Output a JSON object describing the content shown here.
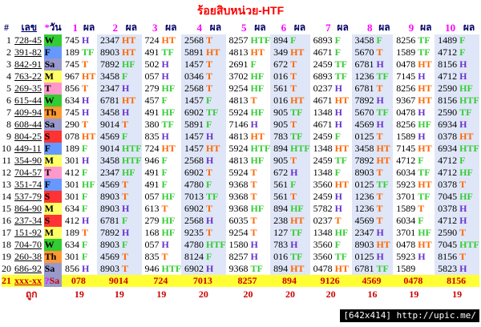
{
  "title": "ร้อยสิบหน่วย-HTF",
  "headers": {
    "hash": "#",
    "lek": "เลข",
    "star": "*",
    "wan": "วัน",
    "phl": "ผล",
    "ranks": [
      "1",
      "2",
      "3",
      "4",
      "5",
      "6",
      "7",
      "8",
      "9",
      "10"
    ]
  },
  "day_colors": {
    "W": "#33cc33",
    "F": "#6699ff",
    "Sa": "#9999cc",
    "M": "#ffff66",
    "T": "#ff99cc",
    "S": "#ff3333",
    "Th": "#ff9933"
  },
  "letter_colors": {
    "H": "#6633cc",
    "T": "#ff6600",
    "F": "#33cc33",
    "HT": "#ff6600",
    "TF": "#33cc33",
    "HF": "#33cc33",
    "HTF": "#33cc33"
  },
  "rows": [
    {
      "n": "1",
      "lek": "728-45",
      "day": "W",
      "c": [
        [
          "745",
          "H"
        ],
        [
          "2347",
          "HT"
        ],
        [
          "724",
          "HT"
        ],
        [
          "2568",
          "T"
        ],
        [
          "8257",
          "HTF"
        ],
        [
          "894",
          "F"
        ],
        [
          "6893",
          "F"
        ],
        [
          "3458",
          "F"
        ],
        [
          "8256",
          "TF"
        ],
        [
          "1489",
          "F"
        ]
      ]
    },
    {
      "n": "2",
      "lek": "391-82",
      "day": "F",
      "c": [
        [
          "189",
          "TF"
        ],
        [
          "8903",
          "HT"
        ],
        [
          "491",
          "TF"
        ],
        [
          "5891",
          "HT"
        ],
        [
          "4813",
          "HT"
        ],
        [
          "349",
          "HT"
        ],
        [
          "4671",
          "F"
        ],
        [
          "5670",
          "T"
        ],
        [
          "1589",
          "TF"
        ],
        [
          "4712",
          "F"
        ]
      ]
    },
    {
      "n": "3",
      "lek": "842-91",
      "day": "Sa",
      "c": [
        [
          "745",
          "T"
        ],
        [
          "7892",
          "HF"
        ],
        [
          "502",
          "H"
        ],
        [
          "1457",
          "T"
        ],
        [
          "2691",
          "F"
        ],
        [
          "672",
          "T"
        ],
        [
          "2459",
          "TF"
        ],
        [
          "6781",
          "H"
        ],
        [
          "0478",
          "HT"
        ],
        [
          "8156",
          "H"
        ]
      ]
    },
    {
      "n": "4",
      "lek": "763-22",
      "day": "M",
      "c": [
        [
          "967",
          "HT"
        ],
        [
          "3458",
          "F"
        ],
        [
          "057",
          "H"
        ],
        [
          "0346",
          "T"
        ],
        [
          "3702",
          "HF"
        ],
        [
          "016",
          "T"
        ],
        [
          "6893",
          "TF"
        ],
        [
          "1236",
          "TF"
        ],
        [
          "7145",
          "H"
        ],
        [
          "4712",
          "H"
        ]
      ]
    },
    {
      "n": "5",
      "lek": "269-35",
      "day": "T",
      "c": [
        [
          "856",
          "T"
        ],
        [
          "2347",
          "H"
        ],
        [
          "279",
          "HF"
        ],
        [
          "2568",
          "T"
        ],
        [
          "9254",
          "HF"
        ],
        [
          "561",
          "T"
        ],
        [
          "0237",
          "H"
        ],
        [
          "6781",
          "T"
        ],
        [
          "8256",
          "HT"
        ],
        [
          "2590",
          "HF"
        ]
      ]
    },
    {
      "n": "6",
      "lek": "615-44",
      "day": "W",
      "c": [
        [
          "634",
          "H"
        ],
        [
          "6781",
          "HT"
        ],
        [
          "457",
          "F"
        ],
        [
          "1457",
          "F"
        ],
        [
          "4813",
          "T"
        ],
        [
          "016",
          "HT"
        ],
        [
          "4671",
          "HT"
        ],
        [
          "7892",
          "H"
        ],
        [
          "9367",
          "HT"
        ],
        [
          "8156",
          "HTF"
        ]
      ]
    },
    {
      "n": "7",
      "lek": "409-94",
      "day": "Th",
      "c": [
        [
          "745",
          "H"
        ],
        [
          "3458",
          "H"
        ],
        [
          "491",
          "HF"
        ],
        [
          "6902",
          "TF"
        ],
        [
          "5924",
          "HF"
        ],
        [
          "905",
          "TF"
        ],
        [
          "1348",
          "H"
        ],
        [
          "5670",
          "TF"
        ],
        [
          "0478",
          "H"
        ],
        [
          "2590",
          "TF"
        ]
      ]
    },
    {
      "n": "8",
      "lek": "608-44",
      "day": "Sa",
      "c": [
        [
          "290",
          "T"
        ],
        [
          "9014",
          "T"
        ],
        [
          "380",
          "TF"
        ],
        [
          "5891",
          "F"
        ],
        [
          "7146",
          "H"
        ],
        [
          "905",
          "T"
        ],
        [
          "4671",
          "H"
        ],
        [
          "4569",
          "H"
        ],
        [
          "8256",
          "HF"
        ],
        [
          "6934",
          "H"
        ]
      ]
    },
    {
      "n": "9",
      "lek": "804-25",
      "day": "S",
      "c": [
        [
          "078",
          "HT"
        ],
        [
          "4569",
          "F"
        ],
        [
          "835",
          "H"
        ],
        [
          "1457",
          "H"
        ],
        [
          "4813",
          "HT"
        ],
        [
          "783",
          "TF"
        ],
        [
          "2459",
          "F"
        ],
        [
          "0125",
          "T"
        ],
        [
          "1589",
          "H"
        ],
        [
          "0378",
          "HT"
        ]
      ]
    },
    {
      "n": "10",
      "lek": "449-11",
      "day": "F",
      "c": [
        [
          "189",
          "F"
        ],
        [
          "9014",
          "HTF"
        ],
        [
          "724",
          "HT"
        ],
        [
          "1457",
          "HT"
        ],
        [
          "5924",
          "HTF"
        ],
        [
          "894",
          "HTF"
        ],
        [
          "1348",
          "HT"
        ],
        [
          "3458",
          "HT"
        ],
        [
          "7145",
          "HT"
        ],
        [
          "6934",
          "HTF"
        ]
      ]
    },
    {
      "n": "11",
      "lek": "354-90",
      "day": "M",
      "c": [
        [
          "301",
          "H"
        ],
        [
          "3458",
          "HTF"
        ],
        [
          "946",
          "F"
        ],
        [
          "2568",
          "H"
        ],
        [
          "4813",
          "HF"
        ],
        [
          "905",
          "T"
        ],
        [
          "2459",
          "TF"
        ],
        [
          "7892",
          "HT"
        ],
        [
          "4712",
          "F"
        ],
        [
          "4712",
          "F"
        ]
      ]
    },
    {
      "n": "12",
      "lek": "704-57",
      "day": "T",
      "c": [
        [
          "412",
          "F"
        ],
        [
          "2347",
          "HF"
        ],
        [
          "491",
          "F"
        ],
        [
          "6902",
          "T"
        ],
        [
          "5924",
          "T"
        ],
        [
          "672",
          "H"
        ],
        [
          "1348",
          "F"
        ],
        [
          "8903",
          "T"
        ],
        [
          "6034",
          "TF"
        ],
        [
          "4712",
          "HF"
        ]
      ]
    },
    {
      "n": "13",
      "lek": "351-74",
      "day": "F",
      "c": [
        [
          "301",
          "HF"
        ],
        [
          "4569",
          "T"
        ],
        [
          "491",
          "F"
        ],
        [
          "4780",
          "F"
        ],
        [
          "9368",
          "T"
        ],
        [
          "561",
          "F"
        ],
        [
          "3560",
          "HT"
        ],
        [
          "0125",
          "TF"
        ],
        [
          "5923",
          "HT"
        ],
        [
          "0378",
          "T"
        ]
      ]
    },
    {
      "n": "14",
      "lek": "537-79",
      "day": "S",
      "c": [
        [
          "301",
          "F"
        ],
        [
          "8903",
          "T"
        ],
        [
          "057",
          "HF"
        ],
        [
          "7013",
          "TF"
        ],
        [
          "9368",
          "T"
        ],
        [
          "561",
          "T"
        ],
        [
          "2459",
          "H"
        ],
        [
          "1236",
          "T"
        ],
        [
          "3701",
          "TF"
        ],
        [
          "7045",
          "HF"
        ]
      ]
    },
    {
      "n": "15",
      "lek": "864-90",
      "day": "M",
      "c": [
        [
          "634",
          "F"
        ],
        [
          "8903",
          "H"
        ],
        [
          "613",
          "T"
        ],
        [
          "6902",
          "T"
        ],
        [
          "9368",
          "HF"
        ],
        [
          "894",
          "HF"
        ],
        [
          "5782",
          "H"
        ],
        [
          "1236",
          "T"
        ],
        [
          "1589",
          "T"
        ],
        [
          "0378",
          "H"
        ]
      ]
    },
    {
      "n": "16",
      "lek": "237-34",
      "day": "S",
      "c": [
        [
          "412",
          "H"
        ],
        [
          "6781",
          "F"
        ],
        [
          "279",
          "HF"
        ],
        [
          "2568",
          "H"
        ],
        [
          "6035",
          "T"
        ],
        [
          "238",
          "HT"
        ],
        [
          "0237",
          "T"
        ],
        [
          "4569",
          "T"
        ],
        [
          "6034",
          "F"
        ],
        [
          "4712",
          "H"
        ]
      ]
    },
    {
      "n": "17",
      "lek": "151-92",
      "day": "M",
      "c": [
        [
          "189",
          "T"
        ],
        [
          "7892",
          "H"
        ],
        [
          "168",
          "HF"
        ],
        [
          "9235",
          "T"
        ],
        [
          "9254",
          "T"
        ],
        [
          "127",
          "TF"
        ],
        [
          "1348",
          "HF"
        ],
        [
          "2347",
          "H"
        ],
        [
          "3701",
          "HF"
        ],
        [
          "2590",
          "T"
        ]
      ]
    },
    {
      "n": "18",
      "lek": "704-70",
      "day": "W",
      "c": [
        [
          "634",
          "F"
        ],
        [
          "8903",
          "F"
        ],
        [
          "057",
          "H"
        ],
        [
          "4780",
          "HTF"
        ],
        [
          "1580",
          "H"
        ],
        [
          "783",
          "H"
        ],
        [
          "3560",
          "F"
        ],
        [
          "8903",
          "HT"
        ],
        [
          "0478",
          "HT"
        ],
        [
          "7045",
          "HTF"
        ]
      ]
    },
    {
      "n": "19",
      "lek": "260-38",
      "day": "Th",
      "c": [
        [
          "301",
          "F"
        ],
        [
          "4569",
          "T"
        ],
        [
          "835",
          "T"
        ],
        [
          "8124",
          "F"
        ],
        [
          "8257",
          "H"
        ],
        [
          "016",
          "TF"
        ],
        [
          "3560",
          "TF"
        ],
        [
          "0125",
          "H"
        ],
        [
          "5923",
          "H"
        ],
        [
          "8156",
          "T"
        ]
      ]
    },
    {
      "n": "20",
      "lek": "686-92",
      "day": "Sa",
      "c": [
        [
          "856",
          "H"
        ],
        [
          "8903",
          "T"
        ],
        [
          "946",
          "HTF"
        ],
        [
          "6902",
          "H"
        ],
        [
          "9368",
          "TF"
        ],
        [
          "894",
          "HT"
        ],
        [
          "0478",
          "HT"
        ],
        [
          "6781",
          "TF"
        ],
        [
          "1589",
          "",
          ""
        ],
        [
          "5823",
          "H"
        ]
      ]
    }
  ],
  "total": {
    "n": "21",
    "lek": "xxx-xx",
    "star": "?",
    "day": "Sa",
    "values": [
      "078",
      "9014",
      "724",
      "7013",
      "8257",
      "894",
      "9126",
      "4569",
      "0478",
      "8156"
    ]
  },
  "counts": {
    "label": "ถูก",
    "values": [
      "19",
      "19",
      "19",
      "20",
      "20",
      "20",
      "20",
      "16",
      "19",
      "19"
    ]
  },
  "watermark": "[642x414] http://upic.me/"
}
